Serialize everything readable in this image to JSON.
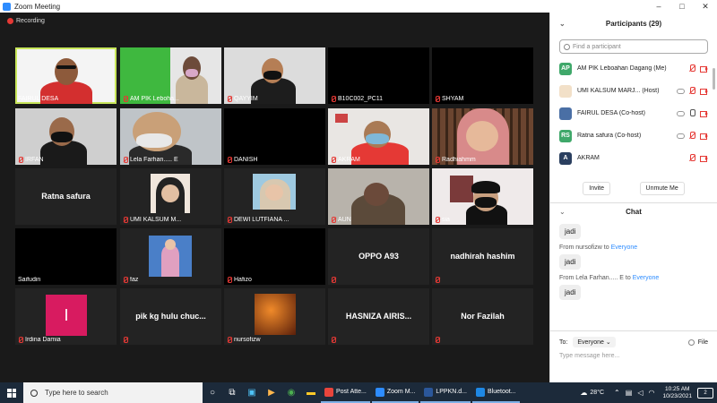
{
  "window": {
    "title": "Zoom Meeting",
    "minimize": "–",
    "maximize": "□",
    "close": "✕"
  },
  "recording": {
    "label": "Recording"
  },
  "tiles": [
    {
      "name": "FAIRUL DESA"
    },
    {
      "name": "AM PIK Leboha..."
    },
    {
      "name": "QAYYIM"
    },
    {
      "name": "B10C002_PC11"
    },
    {
      "name": "SHYAM"
    },
    {
      "name": "IRFAN"
    },
    {
      "name": "Lela Farhan..... E"
    },
    {
      "name": "DANISH"
    },
    {
      "name": "AKRAM"
    },
    {
      "name": "Radhiahmm"
    },
    {
      "name": "Ratna safura",
      "center": "Ratna safura"
    },
    {
      "name": "UMI KALSUM M..."
    },
    {
      "name": "DEWI LUTFIANA ..."
    },
    {
      "name": "AUN"
    },
    {
      "name": "sia"
    },
    {
      "name": "Saifudin"
    },
    {
      "name": "faz"
    },
    {
      "name": "Hafizo"
    },
    {
      "name": "",
      "center": "OPPO A93"
    },
    {
      "name": "",
      "center": "nadhirah hashim"
    },
    {
      "name": "Irdina Damia",
      "initial": "I"
    },
    {
      "name": "",
      "center": "pik kg hulu chuc..."
    },
    {
      "name": "nursofizw"
    },
    {
      "name": "",
      "center": "HASNIZA AIRIS..."
    },
    {
      "name": "",
      "center": "Nor Fazilah"
    }
  ],
  "participants": {
    "title": "Participants (29)",
    "search_placeholder": "Find a participant",
    "items": [
      {
        "initials": "AP",
        "name": "AM PIK Leboahan Dagang (Me)",
        "color": "#3fa86a"
      },
      {
        "initials": "",
        "name": "UMI KALSUM MARJ... (Host)",
        "color": "#f2e0c8"
      },
      {
        "initials": "",
        "name": "FAIRUL DESA (Co-host)",
        "color": "#4a6fa5"
      },
      {
        "initials": "RS",
        "name": "Ratna safura (Co-host)",
        "color": "#3fa86a"
      },
      {
        "initials": "A",
        "name": "AKRAM",
        "color": "#2a3f5f"
      }
    ],
    "invite_label": "Invite",
    "unmute_label": "Unmute Me"
  },
  "chat": {
    "title": "Chat",
    "messages": [
      {
        "from": "",
        "to": "",
        "text": "jadi"
      },
      {
        "from": "From nursofizw to ",
        "to": "Everyone",
        "text": "jadi"
      },
      {
        "from": "From Lela Farhan..... E to ",
        "to": "Everyone",
        "text": "jadi"
      }
    ],
    "to_label": "To:",
    "to_value": "Everyone",
    "file_label": "File",
    "placeholder": "Type message here..."
  },
  "taskbar": {
    "search_placeholder": "Type here to search",
    "apps": [
      {
        "label": "Post Atte...",
        "color": "#e8453c"
      },
      {
        "label": "Zoom M...",
        "color": "#2d8cff"
      },
      {
        "label": "LPPKN.d...",
        "color": "#2b579a"
      },
      {
        "label": "Bluetoot...",
        "color": "#1e88e5"
      }
    ],
    "temperature": "28°C",
    "time": "10:25 AM",
    "date": "10/23/2021",
    "notifications": "2"
  }
}
